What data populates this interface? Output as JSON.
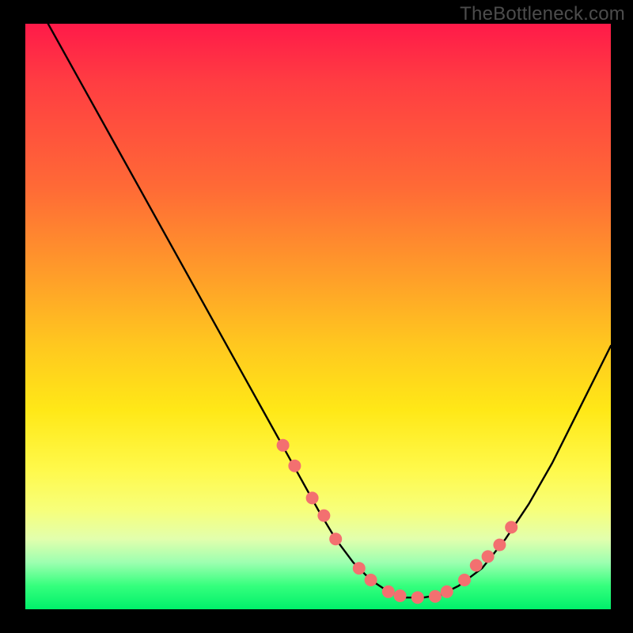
{
  "watermark": "TheBottleneck.com",
  "chart_data": {
    "type": "line",
    "title": "",
    "xlabel": "",
    "ylabel": "",
    "xlim": [
      0,
      100
    ],
    "ylim": [
      0,
      100
    ],
    "grid": false,
    "legend": false,
    "series": [
      {
        "name": "bottleneck-curve",
        "x": [
          0,
          5,
          10,
          15,
          20,
          25,
          30,
          35,
          40,
          45,
          50,
          53,
          56,
          59,
          62,
          65,
          68,
          71,
          74,
          78,
          82,
          86,
          90,
          94,
          98,
          100
        ],
        "y": [
          107,
          98,
          89,
          80,
          71,
          62,
          53,
          44,
          35,
          26,
          17,
          12,
          8,
          5,
          3,
          2,
          2,
          2.5,
          4,
          7,
          12,
          18,
          25,
          33,
          41,
          45
        ]
      }
    ],
    "markers": {
      "name": "highlighted-points",
      "color": "#f37070",
      "radius_px": 8,
      "x": [
        44,
        46,
        49,
        51,
        53,
        57,
        59,
        62,
        64,
        67,
        70,
        72,
        75,
        77,
        79,
        81,
        83
      ],
      "y": [
        28,
        24.5,
        19,
        16,
        12,
        7,
        5,
        3,
        2.3,
        2,
        2.2,
        3,
        5,
        7.5,
        9,
        11,
        14
      ]
    },
    "background_gradient": {
      "direction": "vertical",
      "stops": [
        {
          "pos": 0.0,
          "color": "#ff1a49"
        },
        {
          "pos": 0.1,
          "color": "#ff3d42"
        },
        {
          "pos": 0.28,
          "color": "#ff6a36"
        },
        {
          "pos": 0.42,
          "color": "#ff9a2a"
        },
        {
          "pos": 0.55,
          "color": "#ffc81f"
        },
        {
          "pos": 0.66,
          "color": "#ffe817"
        },
        {
          "pos": 0.76,
          "color": "#fff94a"
        },
        {
          "pos": 0.83,
          "color": "#f7ff7a"
        },
        {
          "pos": 0.88,
          "color": "#e2ffad"
        },
        {
          "pos": 0.92,
          "color": "#9dffb0"
        },
        {
          "pos": 0.96,
          "color": "#35ff7d"
        },
        {
          "pos": 1.0,
          "color": "#00f06a"
        }
      ]
    }
  }
}
